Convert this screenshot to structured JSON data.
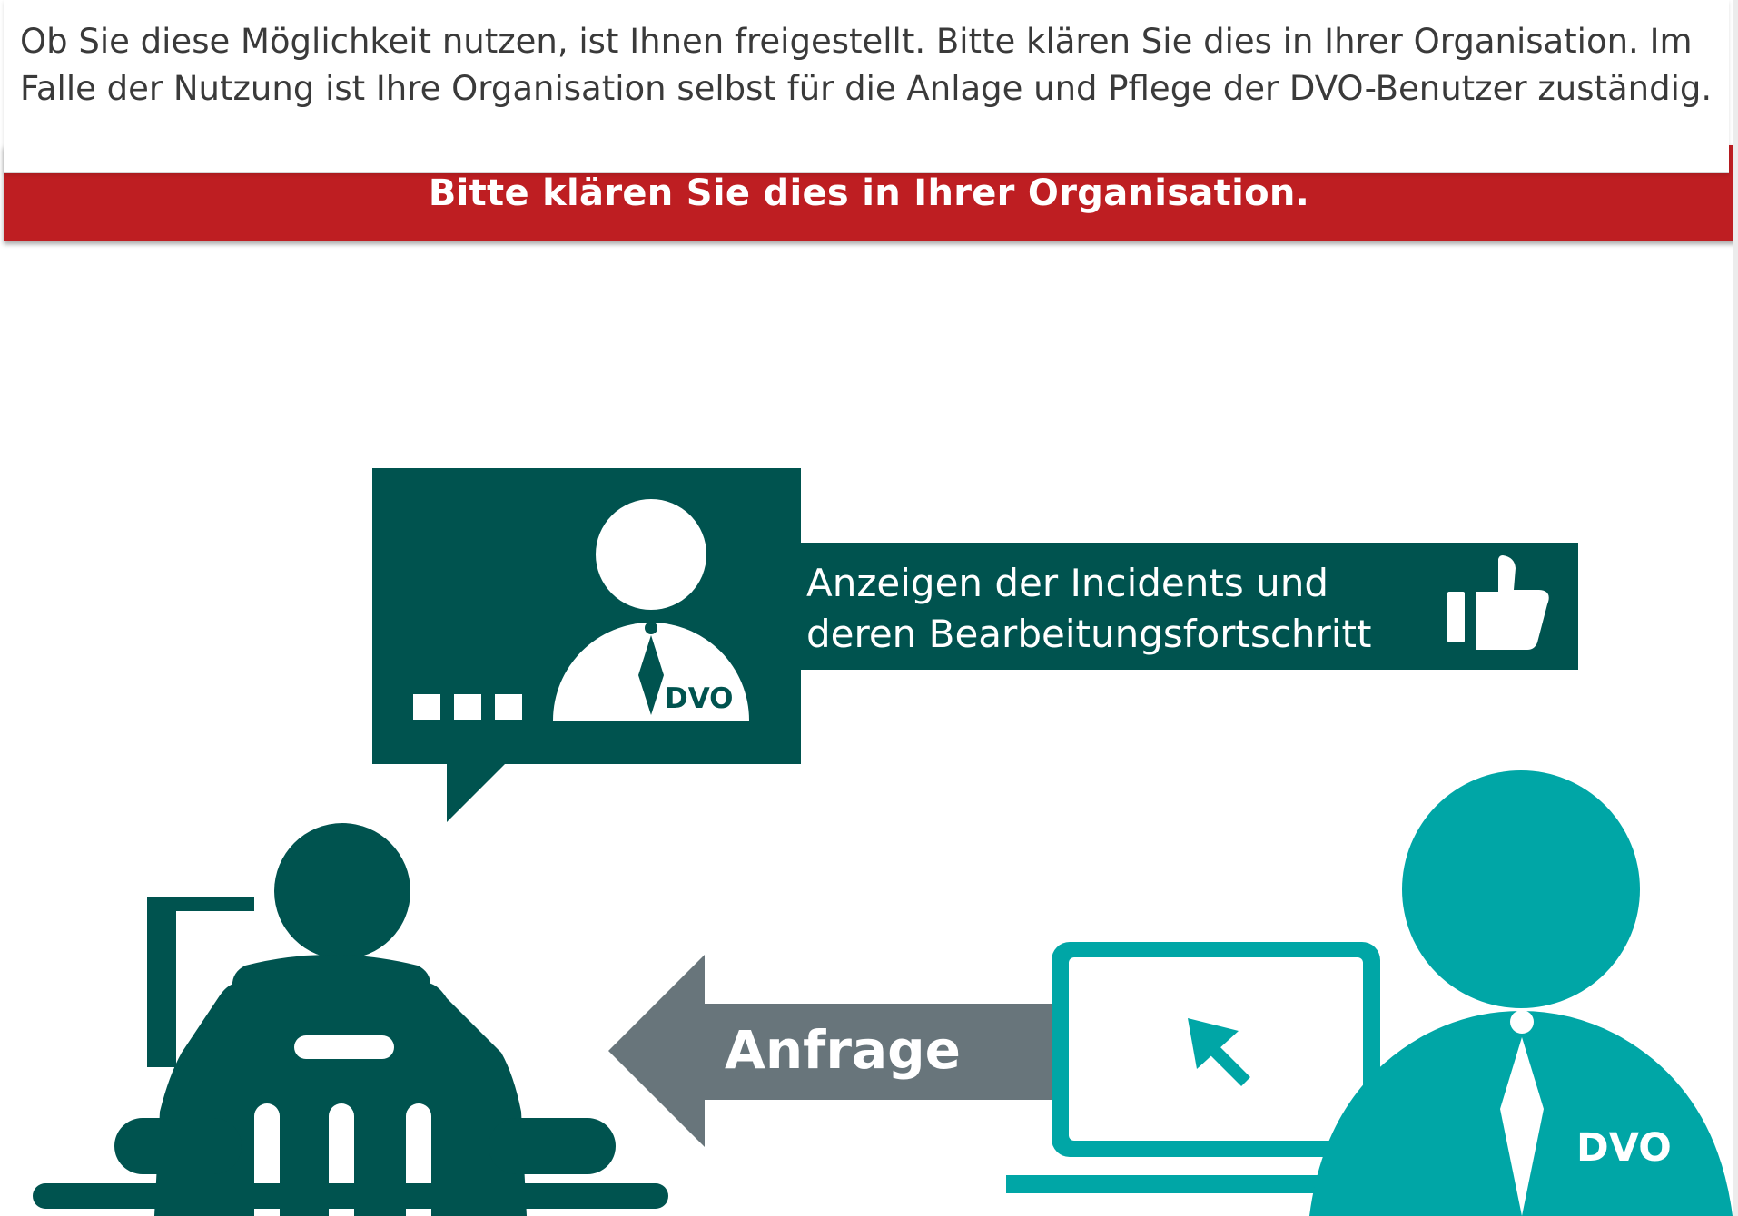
{
  "tooltip": {
    "text": "Ob Sie diese Möglichkeit nutzen, ist Ihnen freigestellt. Bitte klären Sie dies in Ihrer Organisation. Im Falle der Nutzung ist Ihre Organisation selbst für die Anlage und Pflege der DVO-Benutzer zuständig."
  },
  "banner": {
    "text": "Bitte klären Sie dies in Ihrer Organisation."
  },
  "diagram": {
    "info_bar": {
      "line1": "Anzeigen der Incidents und",
      "line2": "deren Bearbeitungsfortschritt"
    },
    "arrow_label": "Anfrage",
    "speech_bubble_badge": "DVO",
    "agent_badge": "DVO"
  },
  "colors": {
    "banner_red": "#be1e22",
    "dark_teal": "#00534f",
    "light_teal": "#00a6a6",
    "arrow_gray": "#68757b",
    "tooltip_text": "#3a3a3a"
  },
  "icons": {
    "thumbs_up": "thumbs-up-icon",
    "cursor": "mouse-pointer-icon",
    "laptop": "laptop-icon",
    "chat_bubble": "speech-bubble-icon",
    "user": "person-icon"
  }
}
